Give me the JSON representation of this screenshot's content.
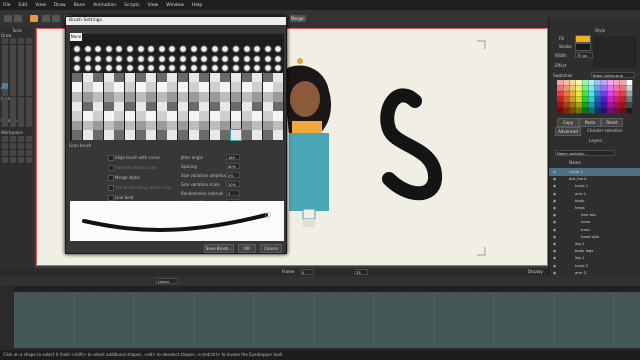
{
  "menu": [
    "File",
    "Edit",
    "View",
    "Draw",
    "Bone",
    "Animation",
    "Scripts",
    "View",
    "Window",
    "Help"
  ],
  "toolbar": {
    "merge_label": "Merge"
  },
  "left_panel": {
    "title": "Tools",
    "sections": [
      "Draw",
      "Fill",
      "Layer",
      "Camera",
      "Workspace"
    ]
  },
  "dialog": {
    "title": "Brush Settings",
    "tab": "None",
    "section_label": "Scan brush",
    "options_left": [
      {
        "label": "Align brush with curve",
        "enabled": true
      },
      {
        "label": "Random stamp order",
        "enabled": false
      },
      {
        "label": "Merge alpha",
        "enabled": true
      },
      {
        "label": "Tint brush using stroke color",
        "enabled": false
      },
      {
        "label": "Line bold",
        "enabled": true
      }
    ],
    "options_right": [
      {
        "label": "Jitter angle",
        "value": "180"
      },
      {
        "label": "Spacing",
        "value": "60%"
      },
      {
        "label": "Size variation amplitude",
        "value": "0%"
      },
      {
        "label": "Size variation scale",
        "value": "20%"
      },
      {
        "label": "Randomness interval",
        "value": "2"
      },
      {
        "label": "Angle shift",
        "value": "0"
      }
    ],
    "buttons": {
      "save": "Save Brush...",
      "ok": "OK",
      "cancel": "Cancel"
    }
  },
  "right_panel": {
    "style_label": "Style",
    "fill_label": "Fill",
    "stroke_label": "Stroke",
    "width_label": "Width",
    "width_value": "75 px",
    "effect_label": "Effect",
    "swatches_label": "Swatches",
    "swatch_set": "Basic Colors.png",
    "copy": "Copy",
    "paste": "Paste",
    "reset": "Reset",
    "advanced": "Advanced",
    "checker": "Checker selection",
    "layers_title": "Layers",
    "layer_filter": "Name contains...",
    "name_col": "Name",
    "fill_color": "#f0b020",
    "stroke_color": "#1a1a1a",
    "layers": [
      {
        "name": "Layer 1",
        "indent": 1,
        "sel": true
      },
      {
        "name": "bot_front",
        "indent": 1
      },
      {
        "name": "hand 1",
        "indent": 2
      },
      {
        "name": "arm 1",
        "indent": 2
      },
      {
        "name": "body",
        "indent": 2
      },
      {
        "name": "head",
        "indent": 2
      },
      {
        "name": "hair top",
        "indent": 3
      },
      {
        "name": "nose",
        "indent": 3
      },
      {
        "name": "tunic",
        "indent": 3
      },
      {
        "name": "head skin",
        "indent": 3
      },
      {
        "name": "leg 2",
        "indent": 2
      },
      {
        "name": "body legs",
        "indent": 2
      },
      {
        "name": "leg 1",
        "indent": 2
      },
      {
        "name": "hand 2",
        "indent": 2
      },
      {
        "name": "arm 2",
        "indent": 2
      },
      {
        "name": "hair back",
        "indent": 2
      }
    ]
  },
  "timeline": {
    "frame_label": "Frame",
    "frame_value": "0",
    "of_value": "23",
    "interp": "Linear",
    "display_label": "Display"
  },
  "status": "Click on a shape to select it (hold <shift> to select additional shapes, <alt> to deselect shapes, <cmd/ctrl> to invoke the Eyedropper tool)",
  "colors": {
    "accent": "#e19a3c",
    "stage_border": "#e25a5a",
    "stage_bg": "#f1efe3",
    "teal": "#445757"
  }
}
